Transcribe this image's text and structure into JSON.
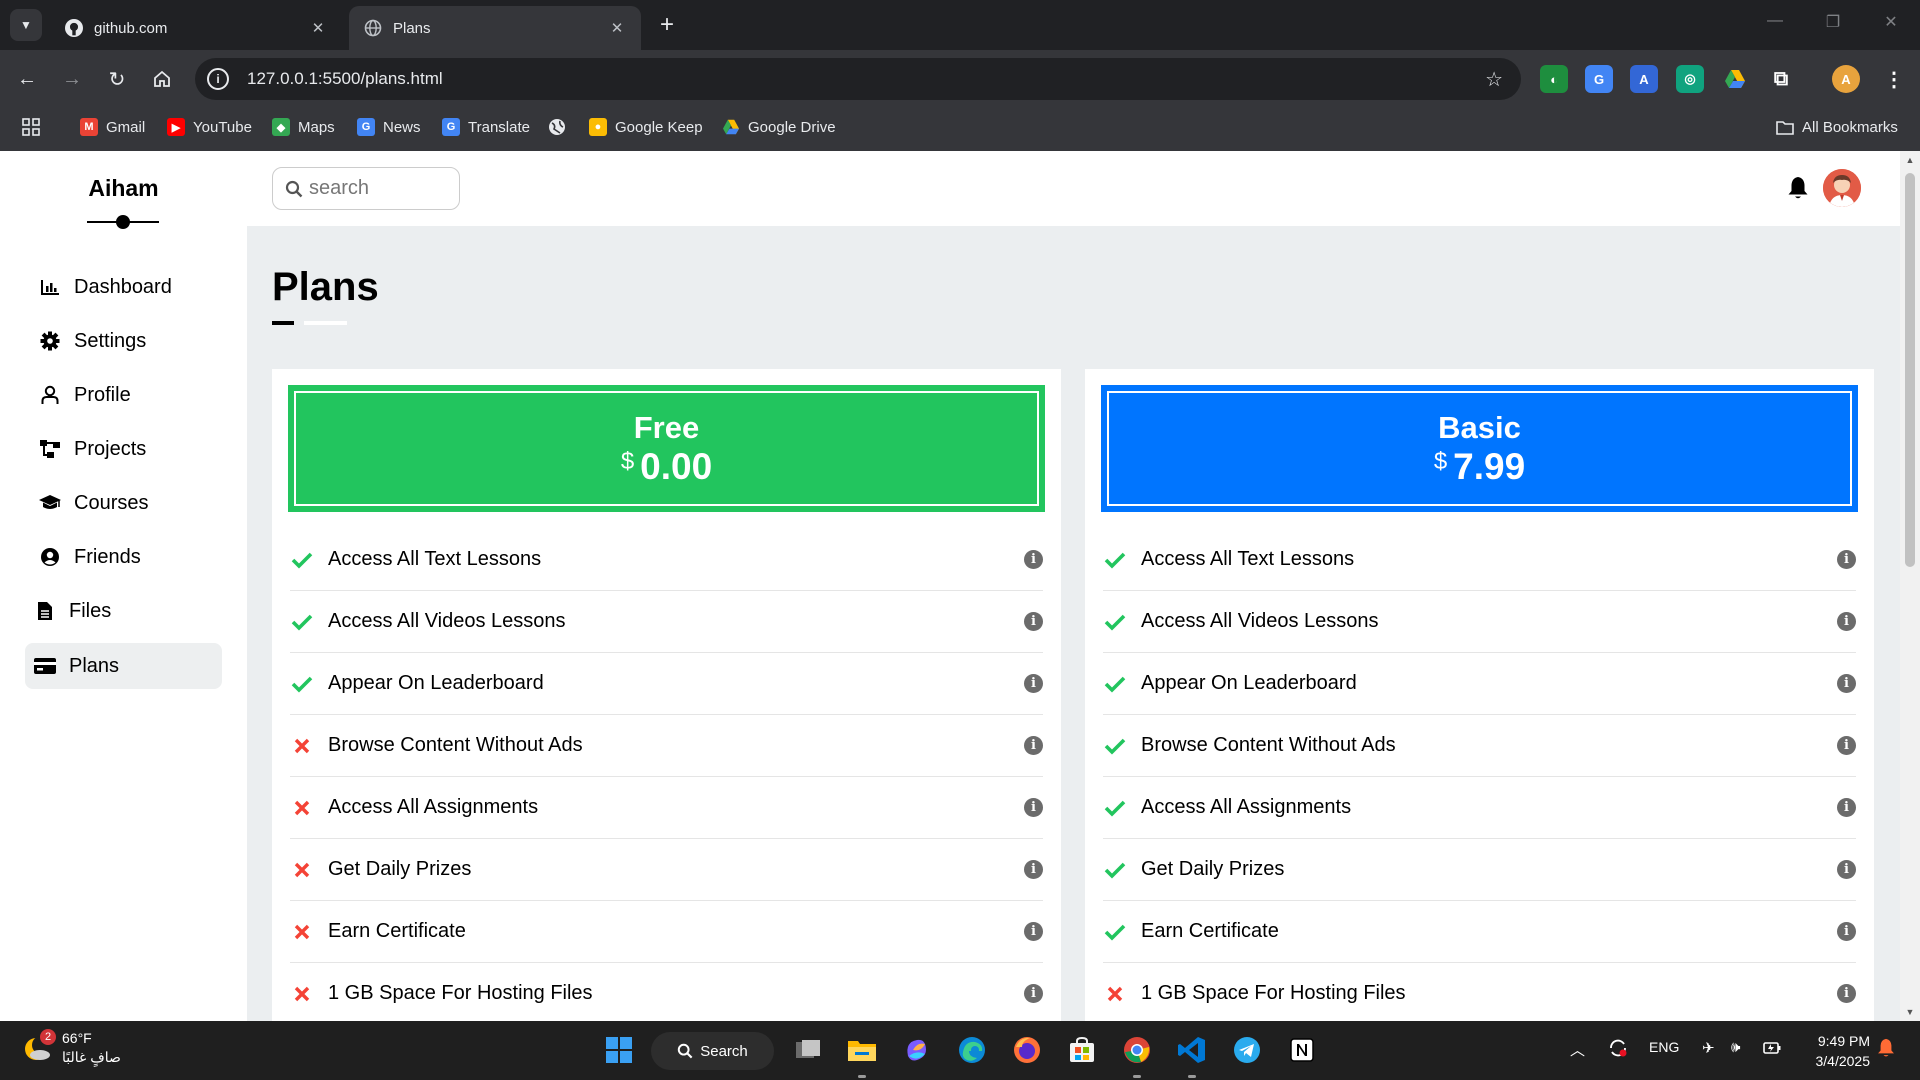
{
  "browser": {
    "tabs": [
      {
        "title": "github.com",
        "active": false
      },
      {
        "title": "Plans",
        "active": true
      }
    ],
    "url": "127.0.0.1:5500/plans.html",
    "bookmarks": [
      {
        "label": "Gmail",
        "icon": "gmail-icon",
        "color": "#ea4335"
      },
      {
        "label": "YouTube",
        "icon": "youtube-icon",
        "color": "#ff0000"
      },
      {
        "label": "Maps",
        "icon": "maps-icon",
        "color": "#34a853"
      },
      {
        "label": "News",
        "icon": "news-icon",
        "color": "#4285f4"
      },
      {
        "label": "Translate",
        "icon": "translate-icon",
        "color": "#4285f4"
      },
      {
        "label": "Google Keep",
        "icon": "keep-icon",
        "color": "#fbbc04"
      },
      {
        "label": "Google Drive",
        "icon": "drive-icon",
        "color": "#34a853"
      }
    ],
    "all_bookmarks": "All Bookmarks"
  },
  "sidebar": {
    "brand": "Aiham",
    "items": [
      {
        "label": "Dashboard",
        "icon": "chart-icon",
        "active": false
      },
      {
        "label": "Settings",
        "icon": "gear-icon",
        "active": false
      },
      {
        "label": "Profile",
        "icon": "user-icon",
        "active": false
      },
      {
        "label": "Projects",
        "icon": "diagram-icon",
        "active": false
      },
      {
        "label": "Courses",
        "icon": "graduation-cap-icon",
        "active": false
      },
      {
        "label": "Friends",
        "icon": "user-circle-icon",
        "active": false
      },
      {
        "label": "Files",
        "icon": "file-icon",
        "active": false
      },
      {
        "label": "Plans",
        "icon": "credit-card-icon",
        "active": true
      }
    ]
  },
  "header": {
    "search_placeholder": "search"
  },
  "main": {
    "title": "Plans",
    "plans": [
      {
        "name": "Free",
        "currency": "$",
        "price": "0.00",
        "color": "#22c55e",
        "features": [
          {
            "label": "Access All Text Lessons",
            "included": true
          },
          {
            "label": "Access All Videos Lessons",
            "included": true
          },
          {
            "label": "Appear On Leaderboard",
            "included": true
          },
          {
            "label": "Browse Content Without Ads",
            "included": false
          },
          {
            "label": "Access All Assignments",
            "included": false
          },
          {
            "label": "Get Daily Prizes",
            "included": false
          },
          {
            "label": "Earn Certificate",
            "included": false
          },
          {
            "label": "1 GB Space For Hosting Files",
            "included": false
          }
        ]
      },
      {
        "name": "Basic",
        "currency": "$",
        "price": "7.99",
        "color": "#0075ff",
        "features": [
          {
            "label": "Access All Text Lessons",
            "included": true
          },
          {
            "label": "Access All Videos Lessons",
            "included": true
          },
          {
            "label": "Appear On Leaderboard",
            "included": true
          },
          {
            "label": "Browse Content Without Ads",
            "included": true
          },
          {
            "label": "Access All Assignments",
            "included": true
          },
          {
            "label": "Get Daily Prizes",
            "included": true
          },
          {
            "label": "Earn Certificate",
            "included": true
          },
          {
            "label": "1 GB Space For Hosting Files",
            "included": false
          }
        ]
      }
    ]
  },
  "taskbar": {
    "weather_temp": "66°F",
    "weather_desc": "صافٍ غالبًا",
    "weather_badge": "2",
    "search_label": "Search",
    "language": "ENG",
    "time": "9:49 PM",
    "date": "3/4/2025"
  }
}
